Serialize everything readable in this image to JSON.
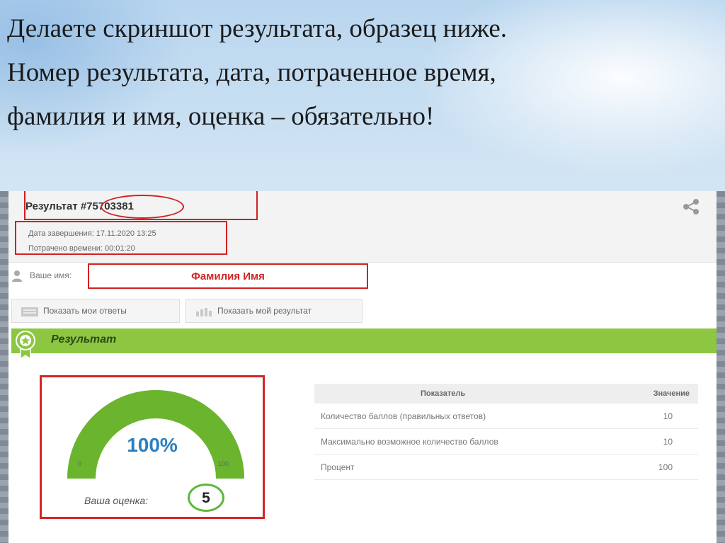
{
  "slide": {
    "line1": "Делаете скриншот результата, образец ниже.",
    "line2": "Номер результата, дата, потраченное время,",
    "line3": "фамилия и имя, оценка – обязательно!"
  },
  "result": {
    "title": "Результат #75703381",
    "completion_date": "Дата завершения: 17.11.2020 13:25",
    "time_spent": "Потрачено времени: 00:01:20"
  },
  "user": {
    "name_label": "Ваше имя:",
    "name_value": "Фамилия Имя"
  },
  "buttons": {
    "show_answers": "Показать мои ответы",
    "show_result": "Показать мой результат"
  },
  "section": {
    "title": "Результат"
  },
  "gauge": {
    "percent_text": "100%",
    "percent": 100,
    "min": "0",
    "max": "100",
    "grade_label": "Ваша оценка:",
    "grade": "5"
  },
  "table": {
    "header_indicator": "Показатель",
    "header_value": "Значение",
    "rows": [
      {
        "label": "Количество баллов (правильных ответов)",
        "value": "10"
      },
      {
        "label": "Максимально возможное количество баллов",
        "value": "10"
      },
      {
        "label": "Процент",
        "value": "100"
      }
    ]
  },
  "colors": {
    "accent_green": "#8dc641",
    "highlight_red": "#d22020",
    "percent_blue": "#2b7fc0"
  }
}
